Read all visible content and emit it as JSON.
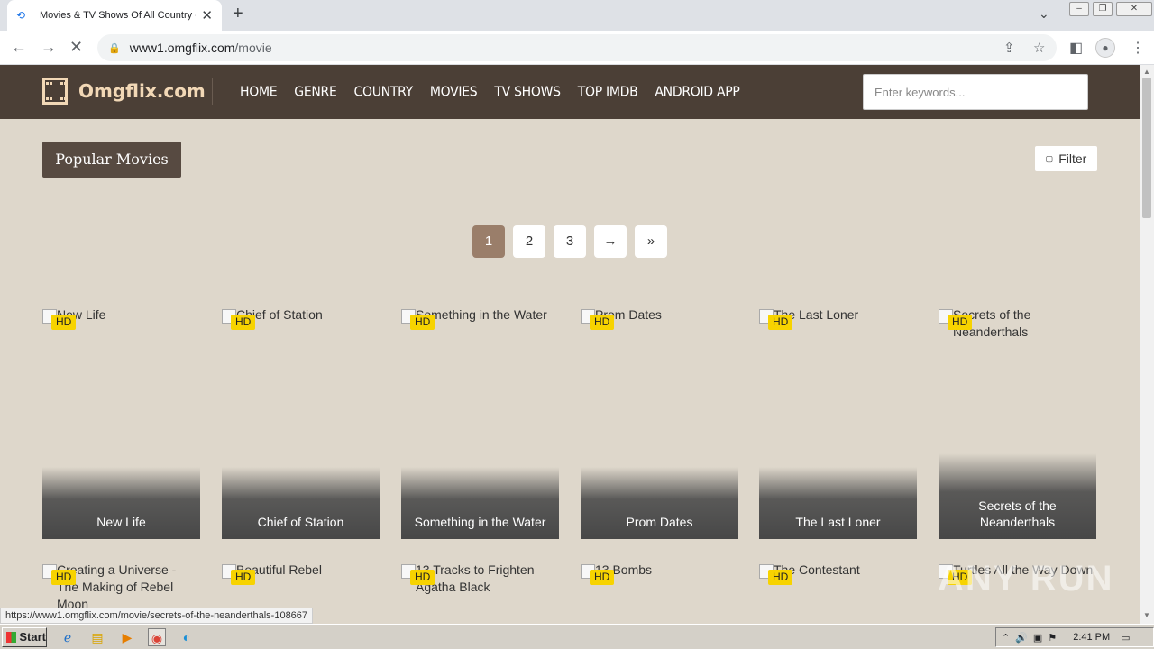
{
  "browser": {
    "tab_title": "Movies & TV Shows Of All Country -",
    "url_host": "www1.omgflix.com",
    "url_path": "/movie",
    "status_url": "https://www1.omgflix.com/movie/secrets-of-the-neanderthals-108667"
  },
  "site": {
    "logo_text": "Omgflix.com",
    "menu": [
      "HOME",
      "GENRE",
      "COUNTRY",
      "MOVIES",
      "TV SHOWS",
      "TOP IMDB",
      "ANDROID APP"
    ],
    "search_placeholder": "Enter keywords..."
  },
  "main": {
    "section_title": "Popular Movies",
    "filter_label": "Filter",
    "pages": [
      "1",
      "2",
      "3",
      "→",
      "»"
    ],
    "active_page": "1",
    "badge": "HD",
    "row1": [
      {
        "alt": "New Life",
        "title": "New Life"
      },
      {
        "alt": "Chief of Station",
        "title": "Chief of Station"
      },
      {
        "alt": "Something in the Water",
        "title": "Something in the Water"
      },
      {
        "alt": "Prom Dates",
        "title": "Prom Dates"
      },
      {
        "alt": "The Last Loner",
        "title": "The Last Loner"
      },
      {
        "alt": "Secrets of the Neanderthals",
        "title": "Secrets of the Neanderthals"
      }
    ],
    "row2": [
      {
        "alt": "Creating a Universe - The Making of Rebel Moon"
      },
      {
        "alt": "Beautiful Rebel"
      },
      {
        "alt": "13 Tracks to Frighten Agatha Black"
      },
      {
        "alt": "13 Bombs"
      },
      {
        "alt": "The Contestant"
      },
      {
        "alt": "Turtles All the Way Down"
      }
    ]
  },
  "watermark": "ANY RUN",
  "taskbar": {
    "start_label": "Start",
    "clock": "2:41 PM"
  }
}
